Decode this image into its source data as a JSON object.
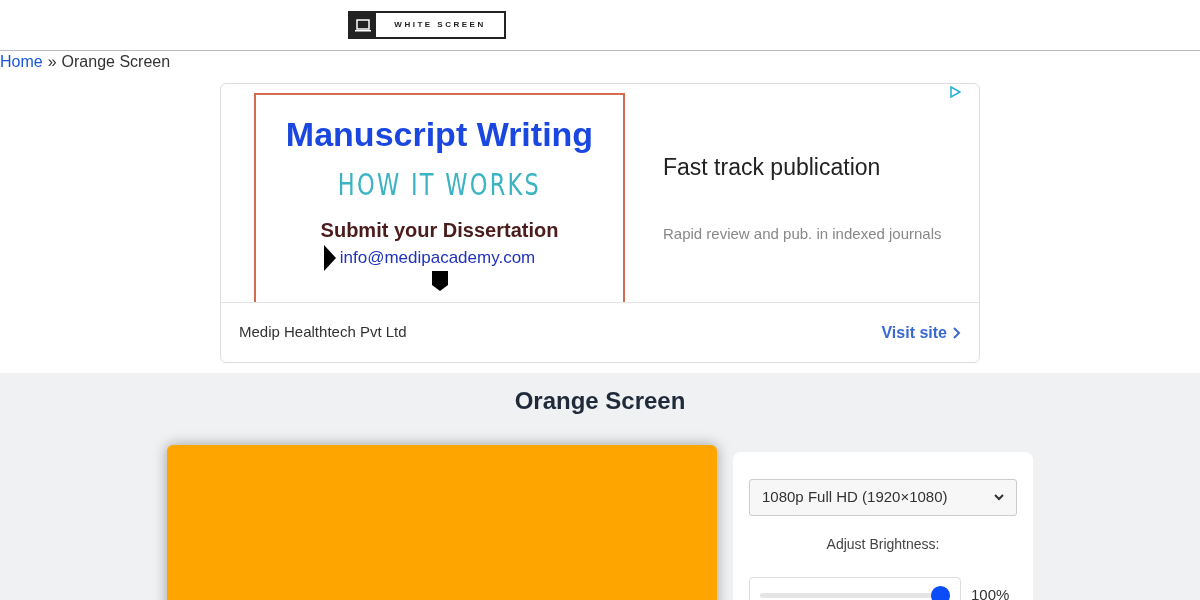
{
  "logo": {
    "text": "WHITE SCREEN"
  },
  "breadcrumb": {
    "home": "Home",
    "separator": "»",
    "current": "Orange Screen"
  },
  "ad": {
    "banner": {
      "headline": "Manuscript Writing",
      "subhead": "HOW IT WORKS",
      "line": "Submit your Dissertation",
      "email": "info@medipacademy.com"
    },
    "title": "Fast track publication",
    "description": "Rapid review and pub. in indexed journals",
    "advertiser": "Medip Healthtech Pvt Ltd",
    "cta": "Visit site"
  },
  "page_title": "Orange Screen",
  "screen": {
    "color": "#ffa500"
  },
  "controls": {
    "resolution": "1080p Full HD (1920×1080)",
    "brightness_label": "Adjust Brightness:",
    "brightness": {
      "level": 1,
      "reading": "100%"
    }
  }
}
